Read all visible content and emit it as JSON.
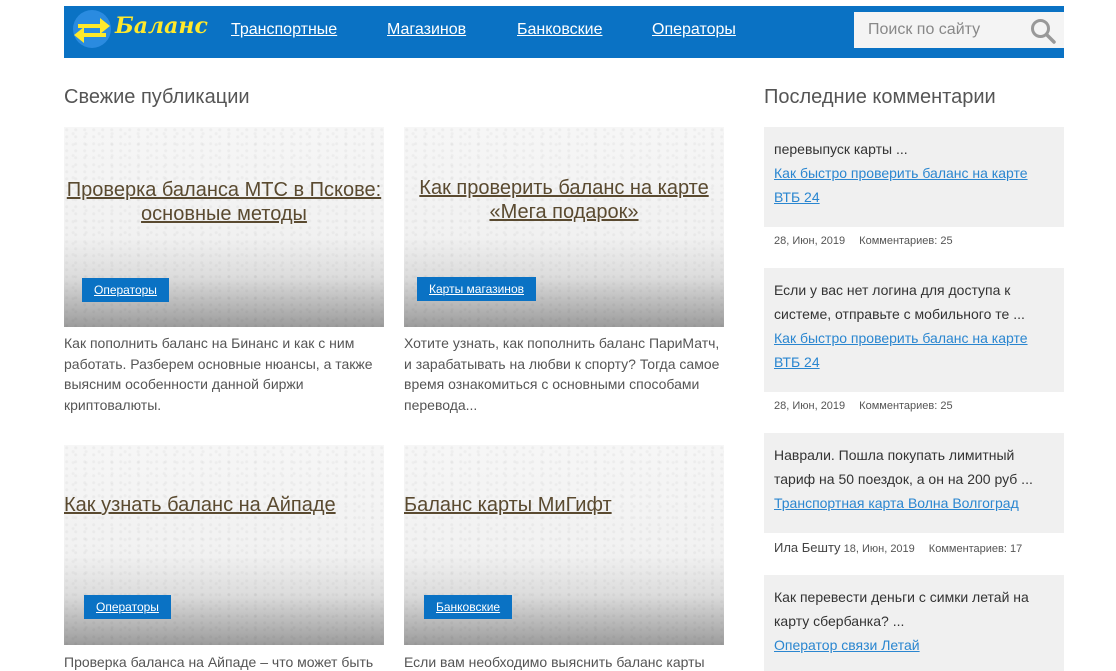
{
  "site": {
    "logo_text": "Баланс",
    "logo_colors": {
      "blue": "#2a8be0",
      "yellow": "#ffe92b",
      "accent": "#0a72c4"
    }
  },
  "nav": {
    "items": [
      "Транспортные",
      "Магазинов",
      "Банковские",
      "Операторы"
    ]
  },
  "search": {
    "placeholder": "Поиск по сайту",
    "icon": "search-icon"
  },
  "posts": {
    "title": "Свежие публикации",
    "items": [
      {
        "title_lines": [
          "Проверка баланса МТС в Пскове:",
          "основные методы"
        ],
        "tag": "Операторы",
        "excerpt_lines": [
          "Как пополнить баланс на Бинанс и как с ним",
          "работать. Разберем основные нюансы, а также",
          "выясним особенности данной биржи",
          "криптовалюты."
        ]
      },
      {
        "title_lines": [
          "Как проверить баланс на карте",
          "«Мега подарок»"
        ],
        "tag": "Карты магазинов",
        "excerpt_lines": [
          "Хотите узнать, как пополнить баланс ПариМатч,",
          "и зарабатывать на любви к спорту? Тогда самое",
          "время ознакомиться с основными способами",
          "перевода..."
        ]
      },
      {
        "title_lines": [
          "Как узнать баланс на Айпаде"
        ],
        "tag": "Операторы",
        "excerpt_lines": [
          "Проверка баланса на Айпаде – что может быть"
        ]
      },
      {
        "title_lines": [
          "Баланс карты МиГифт"
        ],
        "tag": "Банковские",
        "excerpt_lines": [
          "Если вам необходимо выяснить баланс карты"
        ]
      }
    ]
  },
  "comments": {
    "title": "Последние комментарии",
    "label_comments": "Комментариев:",
    "items": [
      {
        "text_lines": [
          "перевыпуск карты ..."
        ],
        "link_lines": [
          "Как быстро проверить баланс на карте",
          "ВТБ 24"
        ],
        "author": "",
        "date": "28, Июн, 2019",
        "count": "25"
      },
      {
        "text_lines": [
          "Если у вас нет логина для доступа к",
          "системе, отправьте с мобильного те ..."
        ],
        "link_lines": [
          "Как быстро проверить баланс на карте",
          "ВТБ 24"
        ],
        "author": "",
        "date": "28, Июн, 2019",
        "count": "25"
      },
      {
        "text_lines": [
          "Наврали. Пошла покупать лимитный",
          "тариф на 50 поездок, а он на 200 руб ..."
        ],
        "link_lines": [
          "Транспортная карта Волна Волгоград"
        ],
        "author": "Ила Бешту",
        "date": "18, Июн, 2019",
        "count": "17"
      },
      {
        "text_lines": [
          "Как перевести деньги с симки летай на",
          "карту сбербанка? ..."
        ],
        "link_lines": [
          "Оператор связи Летай"
        ],
        "author": "",
        "date": "",
        "count": ""
      }
    ]
  }
}
